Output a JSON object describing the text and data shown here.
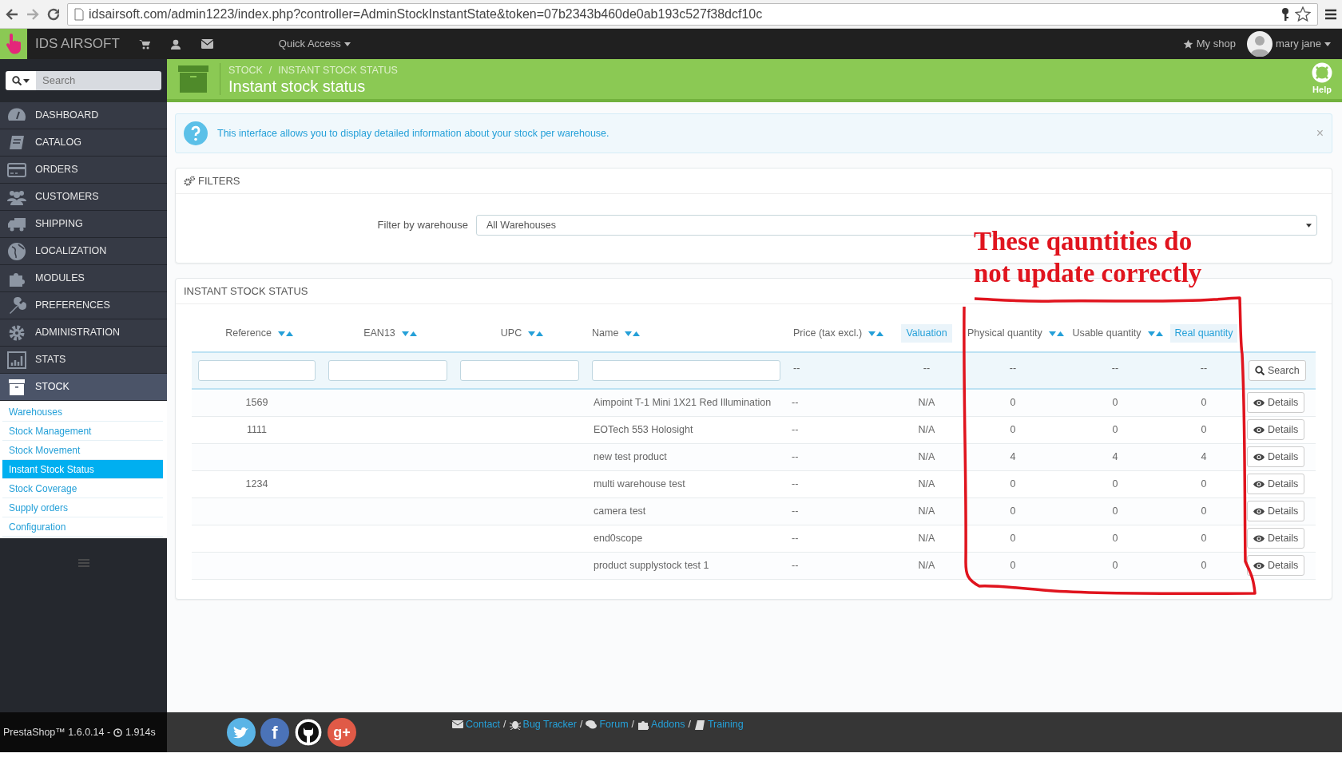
{
  "browser": {
    "url": "idsairsoft.com/admin1223/index.php?controller=AdminStockInstantState&token=07b2343b460de0ab193c527f38dcf10c"
  },
  "topnav": {
    "shop_name": "IDS AIRSOFT",
    "quick_access": "Quick Access",
    "my_shop": "My shop",
    "user": "mary jane"
  },
  "sidebar": {
    "search_placeholder": "Search",
    "items": [
      {
        "label": "DASHBOARD",
        "selected": false
      },
      {
        "label": "CATALOG",
        "selected": false
      },
      {
        "label": "ORDERS",
        "selected": false
      },
      {
        "label": "CUSTOMERS",
        "selected": false
      },
      {
        "label": "SHIPPING",
        "selected": false
      },
      {
        "label": "LOCALIZATION",
        "selected": false
      },
      {
        "label": "MODULES",
        "selected": false
      },
      {
        "label": "PREFERENCES",
        "selected": false
      },
      {
        "label": "ADMINISTRATION",
        "selected": false
      },
      {
        "label": "STATS",
        "selected": false
      },
      {
        "label": "STOCK",
        "selected": true,
        "children": [
          {
            "label": "Warehouses",
            "selected": false
          },
          {
            "label": "Stock Management",
            "selected": false
          },
          {
            "label": "Stock Movement",
            "selected": false
          },
          {
            "label": "Instant Stock Status",
            "selected": true
          },
          {
            "label": "Stock Coverage",
            "selected": false
          },
          {
            "label": "Supply orders",
            "selected": false
          },
          {
            "label": "Configuration",
            "selected": false
          }
        ]
      }
    ]
  },
  "header": {
    "breadcrumb": [
      {
        "label": "STOCK",
        "separator": "/"
      },
      {
        "label": "INSTANT STOCK STATUS"
      }
    ],
    "title": "Instant stock status",
    "help": "Help"
  },
  "alert": {
    "text": "This interface allows you to display detailed information about your stock per warehouse.",
    "close": "×"
  },
  "filters": {
    "title": "FILTERS",
    "label": "Filter by warehouse",
    "value": "All Warehouses"
  },
  "table": {
    "title": "INSTANT STOCK STATUS",
    "columns": [
      {
        "label": "Reference",
        "sortable": true,
        "filter_input": true
      },
      {
        "label": "EAN13",
        "sortable": true,
        "filter_input": true
      },
      {
        "label": "UPC",
        "sortable": true,
        "filter_input": true
      },
      {
        "label": "Name",
        "sortable": true,
        "filter_input": true
      },
      {
        "label": "Price (tax excl.)",
        "sortable": true,
        "filter_input": false,
        "filter_text": "--"
      },
      {
        "label": "Valuation",
        "sortable": false,
        "filter_input": false,
        "filter_text": "--"
      },
      {
        "label": "Physical quantity",
        "sortable": true,
        "filter_input": false,
        "filter_text": "--"
      },
      {
        "label": "Usable quantity",
        "sortable": true,
        "filter_input": false,
        "filter_text": "--"
      },
      {
        "label": "Real quantity",
        "sortable": false,
        "filter_input": false,
        "filter_text": "--"
      }
    ],
    "search_button": "Search",
    "rows": [
      {
        "reference": "1569",
        "name": "Aimpoint T-1 Mini 1X21 Red Illumination",
        "price": "--",
        "valuation": "N/A",
        "physical": "0",
        "usable": "0",
        "real": "0",
        "action": "Details"
      },
      {
        "reference": "1111",
        "name": "EOTech 553 Holosight",
        "price": "--",
        "valuation": "N/A",
        "physical": "0",
        "usable": "0",
        "real": "0",
        "action": "Details"
      },
      {
        "name": "new test product",
        "price": "--",
        "valuation": "N/A",
        "physical": "4",
        "usable": "4",
        "real": "4",
        "action": "Details"
      },
      {
        "reference": "1234",
        "name": "multi warehouse test",
        "price": "--",
        "valuation": "N/A",
        "physical": "0",
        "usable": "0",
        "real": "0",
        "action": "Details"
      },
      {
        "name": "camera test",
        "price": "--",
        "valuation": "N/A",
        "physical": "0",
        "usable": "0",
        "real": "0",
        "action": "Details"
      },
      {
        "name": "end0scope",
        "price": "--",
        "valuation": "N/A",
        "physical": "0",
        "usable": "0",
        "real": "0",
        "action": "Details"
      },
      {
        "name": "product supplystock test 1",
        "price": "--",
        "valuation": "N/A",
        "physical": "0",
        "usable": "0",
        "real": "0",
        "action": "Details"
      }
    ]
  },
  "annotation": {
    "text": "These qauntities do\nnot update correctly"
  },
  "footer": {
    "version": "PrestaShop™ 1.6.0.14 -",
    "load_time": "1.914s",
    "social": [
      {
        "kind": "twitter"
      },
      {
        "kind": "facebook",
        "glyph": "f"
      },
      {
        "kind": "github"
      },
      {
        "kind": "google",
        "glyph": "g+"
      }
    ],
    "links": [
      {
        "label": "Contact",
        "separator": "/"
      },
      {
        "label": "Bug Tracker",
        "separator": "/"
      },
      {
        "label": "Forum",
        "separator": "/"
      },
      {
        "label": "Addons",
        "separator": "/"
      },
      {
        "label": "Training"
      }
    ]
  }
}
